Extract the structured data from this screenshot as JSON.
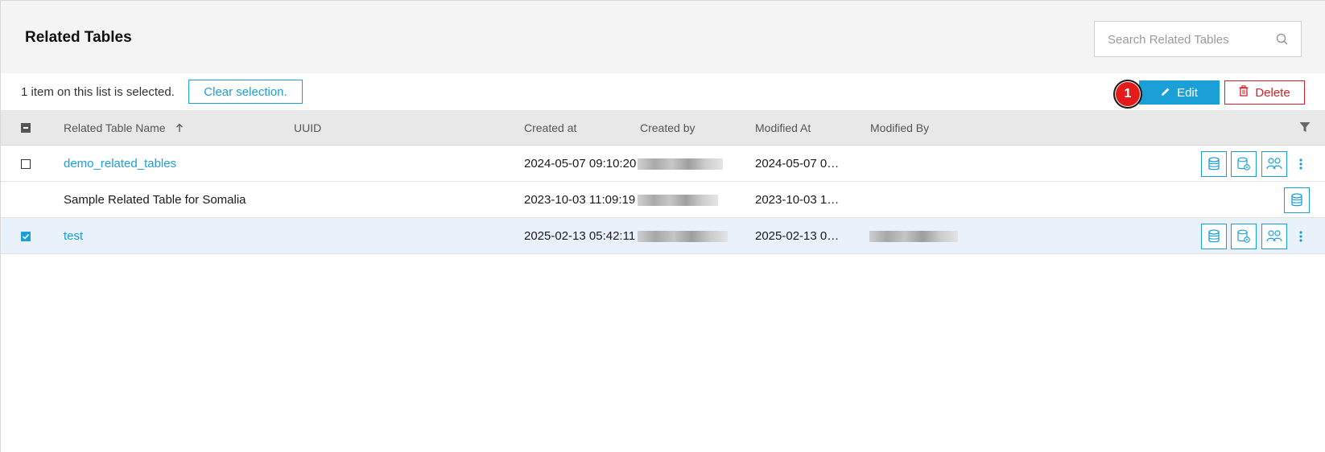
{
  "header": {
    "title": "Related Tables",
    "search_placeholder": "Search Related Tables"
  },
  "selection": {
    "text": "1 item on this list is selected.",
    "clear_label": "Clear selection."
  },
  "toolbar": {
    "badge": "1",
    "edit_label": "Edit",
    "delete_label": "Delete"
  },
  "columns": {
    "name": "Related Table Name",
    "uuid": "UUID",
    "created_at": "Created at",
    "created_by": "Created by",
    "modified_at": "Modified At",
    "modified_by": "Modified By"
  },
  "rows": [
    {
      "name": "demo_related_tables",
      "created_at": "2024-05-07 09:10:20",
      "modified_at": "2024-05-07 0…",
      "checked": false,
      "link": true
    },
    {
      "name": "Sample Related Table for Somalia",
      "created_at": "2023-10-03 11:09:19",
      "modified_at": "2023-10-03 1…",
      "checked": false,
      "link": false
    },
    {
      "name": "test",
      "created_at": "2025-02-13 05:42:11",
      "modified_at": "2025-02-13 0…",
      "checked": true,
      "link": true
    }
  ],
  "colors": {
    "accent": "#1a9fd6",
    "danger": "#d0222a",
    "badge": "#e41b1b"
  },
  "icons": [
    "search-icon",
    "pencil-icon",
    "trash-icon",
    "filter-icon",
    "database-icon",
    "database-settings-icon",
    "users-icon",
    "kebab-menu-icon",
    "sort-ascending-icon"
  ]
}
